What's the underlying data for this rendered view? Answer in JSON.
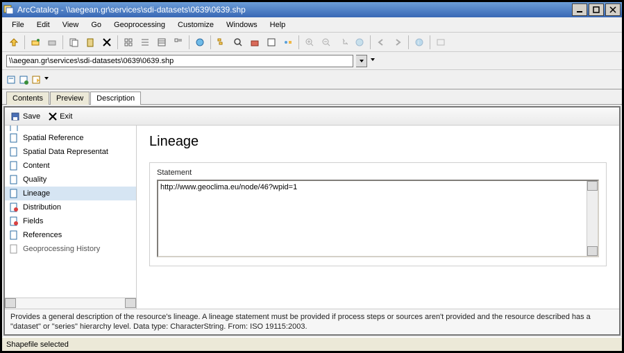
{
  "window": {
    "title": "ArcCatalog - \\\\aegean.gr\\services\\sdi-datasets\\0639\\0639.shp"
  },
  "menu": {
    "file": "File",
    "edit": "Edit",
    "view": "View",
    "go": "Go",
    "geoprocessing": "Geoprocessing",
    "customize": "Customize",
    "windows": "Windows",
    "help": "Help"
  },
  "address": {
    "value": "\\\\aegean.gr\\services\\sdi-datasets\\0639\\0639.shp"
  },
  "tabs": {
    "contents": "Contents",
    "preview": "Preview",
    "description": "Description"
  },
  "subtoolbar": {
    "save": "Save",
    "exit": "Exit"
  },
  "sidebar": {
    "items": [
      {
        "label": "Spatial Reference"
      },
      {
        "label": "Spatial Data Representat"
      },
      {
        "label": "Content"
      },
      {
        "label": "Quality"
      },
      {
        "label": "Lineage"
      },
      {
        "label": "Distribution"
      },
      {
        "label": "Fields"
      },
      {
        "label": "References"
      },
      {
        "label": "Geoprocessing History"
      }
    ]
  },
  "main": {
    "heading": "Lineage",
    "statement_label": "Statement",
    "statement_value": "http://www.geoclima.eu/node/46?wpid=1"
  },
  "help": {
    "text": "Provides a general description of the resource's lineage. A lineage statement must be provided if process steps or sources aren't provided and the resource described has a \"dataset\" or \"series\" hierarchy level. Data type: CharacterString. From: ISO 19115:2003."
  },
  "status": {
    "text": "Shapefile selected"
  }
}
